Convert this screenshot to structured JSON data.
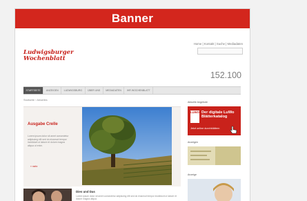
{
  "banner": {
    "label": "Banner"
  },
  "site": {
    "logo_line1": "Ludwigsburger",
    "logo_line2": "Wochenblatt",
    "top_links": "Home | Kontakt | Suche | Mediadaten",
    "counter": "152.100",
    "nav": [
      "Startseite",
      "Anzeigen",
      "Ludwigsburg",
      "Über uns",
      "Mediadaten",
      "Ihr Wochenblatt"
    ],
    "breadcrumb": "Startseite › Aktuelles",
    "feature": {
      "title": "Ausgabe Crelle",
      "text": "Lorem ipsum dolor sit amet consectetur adipiscing elit sed do eiusmod tempor incididunt ut labore et dolore magna aliqua ut enim.",
      "more": "» mehr"
    },
    "sidebar": {
      "catalog_head": "Aktuelle Angebote",
      "catalog_badge": "LUWO",
      "catalog_title": "Der digitale LuWo Blätterkatalog",
      "catalog_link": "Jetzt online durchblättern",
      "promo1_head": "Anzeigen",
      "promo2_head": "Anzeige"
    },
    "article": {
      "title": "Dies und Das",
      "text": "Lorem ipsum dolor sit amet consectetur adipiscing elit sed do eiusmod tempor incididunt ut labore et dolore magna aliqua.",
      "more": "mehr"
    }
  }
}
